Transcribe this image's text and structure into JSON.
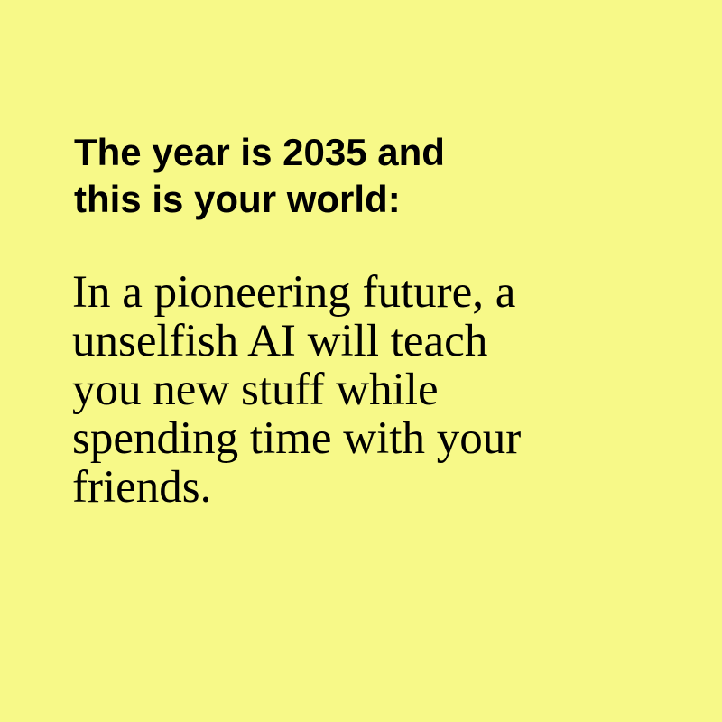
{
  "colors": {
    "background": "#f7f988",
    "text": "#000000"
  },
  "headline": {
    "lines": [
      "The year is 2035 and",
      "this is your world:"
    ]
  },
  "body": {
    "lines": [
      "In a pioneering future, a",
      "unselfish AI will teach",
      "you new stuff while",
      "spending time with your",
      "friends."
    ]
  }
}
